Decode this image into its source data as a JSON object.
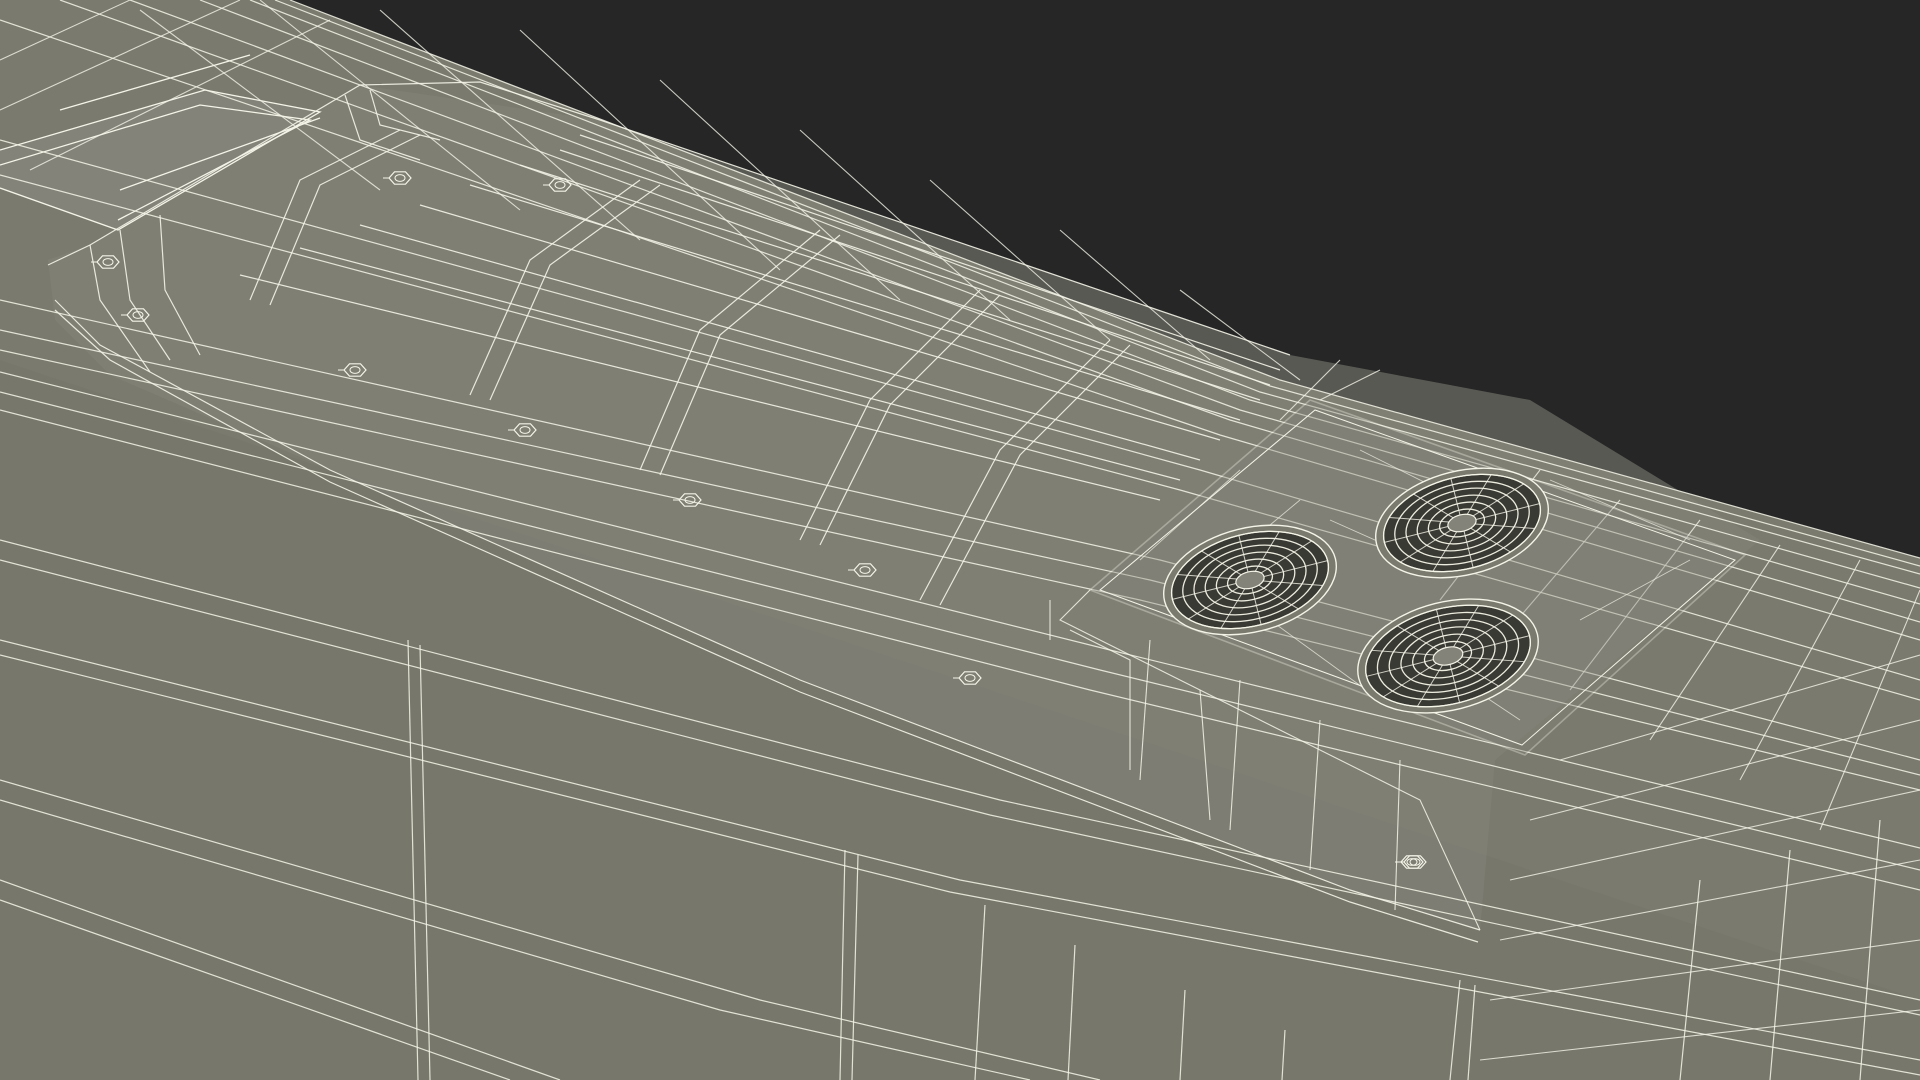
{
  "scene": {
    "subject": "wireframe-3d-render-roof-section",
    "colors": {
      "background": "#262626",
      "surface": "#7a7a6e",
      "surface_shade": "#727266",
      "surface_light": "#83837a",
      "wire": "#f4f4e8",
      "fan_dark": "#3a3a34"
    },
    "visible_fans": 3,
    "visible_bolts": 11
  }
}
